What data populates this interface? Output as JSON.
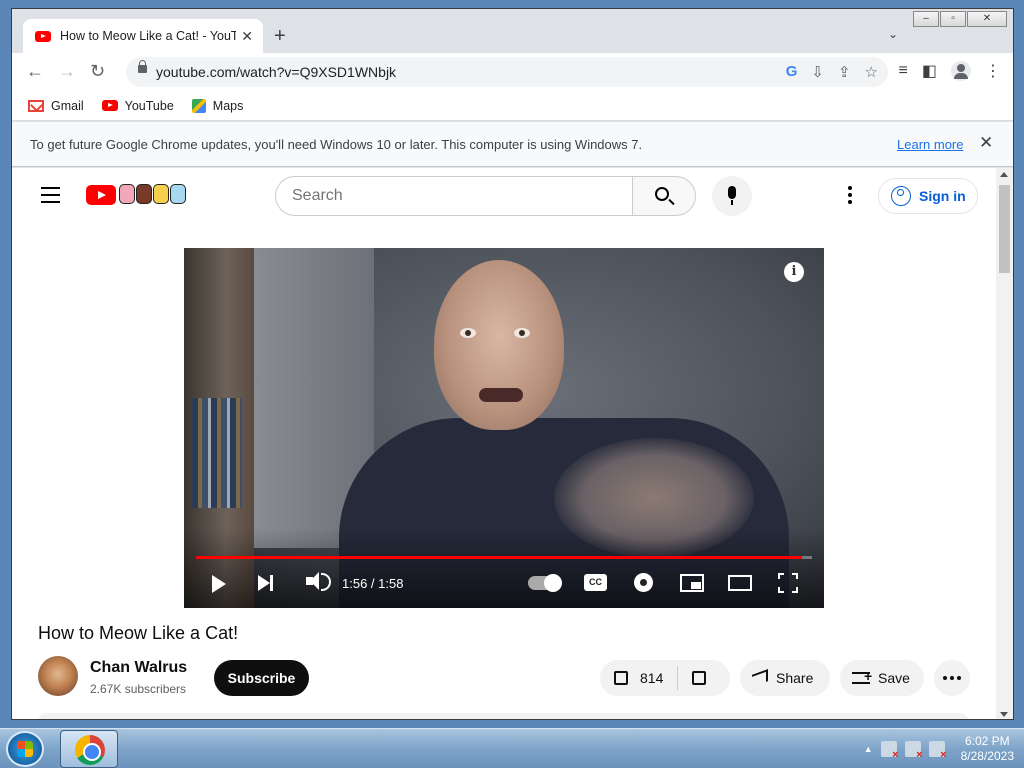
{
  "browser": {
    "tab_title": "How to Meow Like a Cat! - YouTube",
    "url": "youtube.com/watch?v=Q9XSD1WNbjk",
    "bookmarks": [
      {
        "label": "Gmail"
      },
      {
        "label": "YouTube"
      },
      {
        "label": "Maps"
      }
    ],
    "infobar": {
      "message": "To get future Google Chrome updates, you'll need Windows 10 or later. This computer is using Windows 7.",
      "link": "Learn more"
    }
  },
  "youtube": {
    "search_placeholder": "Search",
    "sign_in": "Sign in",
    "player": {
      "time": "1:56 / 1:58",
      "progress": 0.983,
      "cc_label": "CC",
      "info_label": "i"
    },
    "video": {
      "title": "How to Meow Like a Cat!",
      "channel": "Chan Walrus",
      "subscribers": "2.67K subscribers",
      "subscribe_label": "Subscribe",
      "likes": "814",
      "share_label": "Share",
      "save_label": "Save"
    }
  },
  "taskbar": {
    "time": "6:02 PM",
    "date": "8/28/2023"
  },
  "colors": {
    "youtube_red": "#ff0000",
    "link_blue": "#065fd4"
  }
}
